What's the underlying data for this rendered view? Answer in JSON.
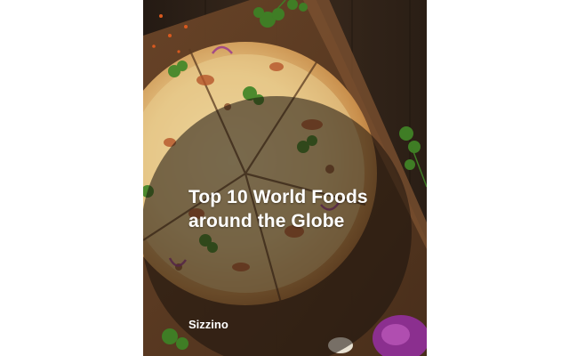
{
  "cover": {
    "title_line1": "Top 10 World Foods",
    "title_line2": "around the Globe",
    "author": "Sizzino"
  },
  "colors": {
    "board_dark": "#2c2118",
    "board_wood": "#5a3b24",
    "pizza_crust": "#d9a35a",
    "cheese": "#ecd6a0",
    "herb": "#4c8a2e",
    "sauce": "#b5552a",
    "onion": "#9b3c8c",
    "text": "#ffffff"
  }
}
